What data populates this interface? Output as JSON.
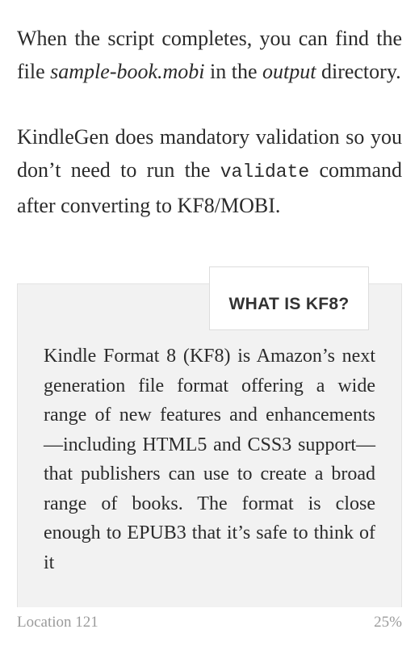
{
  "reader": {
    "body": {
      "paragraphs": [
        {
          "id": "para-1",
          "runs": [
            {
              "text": "When the script completes, you can find the file ",
              "style": "normal"
            },
            {
              "text": "sample-book.mobi",
              "style": "italic"
            },
            {
              "text": " in the ",
              "style": "normal"
            },
            {
              "text": "output",
              "style": "italic"
            },
            {
              "text": " directory.",
              "style": "normal"
            }
          ]
        },
        {
          "id": "para-2",
          "runs": [
            {
              "text": "KindleGen does mandatory validation so you don’t need to run the ",
              "style": "normal"
            },
            {
              "text": "validate",
              "style": "mono"
            },
            {
              "text": " command after converting to KF8/MOBI.",
              "style": "normal"
            }
          ]
        }
      ]
    },
    "sidebar": {
      "heading": "WHAT IS KF8?",
      "body": "Kindle Format 8 (KF8) is Amazon’s next generation file format offering a wide range of new features and enhancements—including HTML5 and CSS3 support—that publishers can use to create a broad range of books. The format is close enough to EPUB3 that it’s safe to think of it"
    },
    "footer": {
      "location_label": "Location 121",
      "progress_percent": "25%"
    },
    "colors": {
      "page_background": "#ffffff",
      "text": "#2b2b2b",
      "sidebar_fill": "#f2f2f2",
      "sidebar_border": "#e2e2e2",
      "heading_box_fill": "#ffffff",
      "heading_box_border": "#dddddd",
      "heading_text": "#333333",
      "footer_text": "#9b9b9b"
    }
  }
}
